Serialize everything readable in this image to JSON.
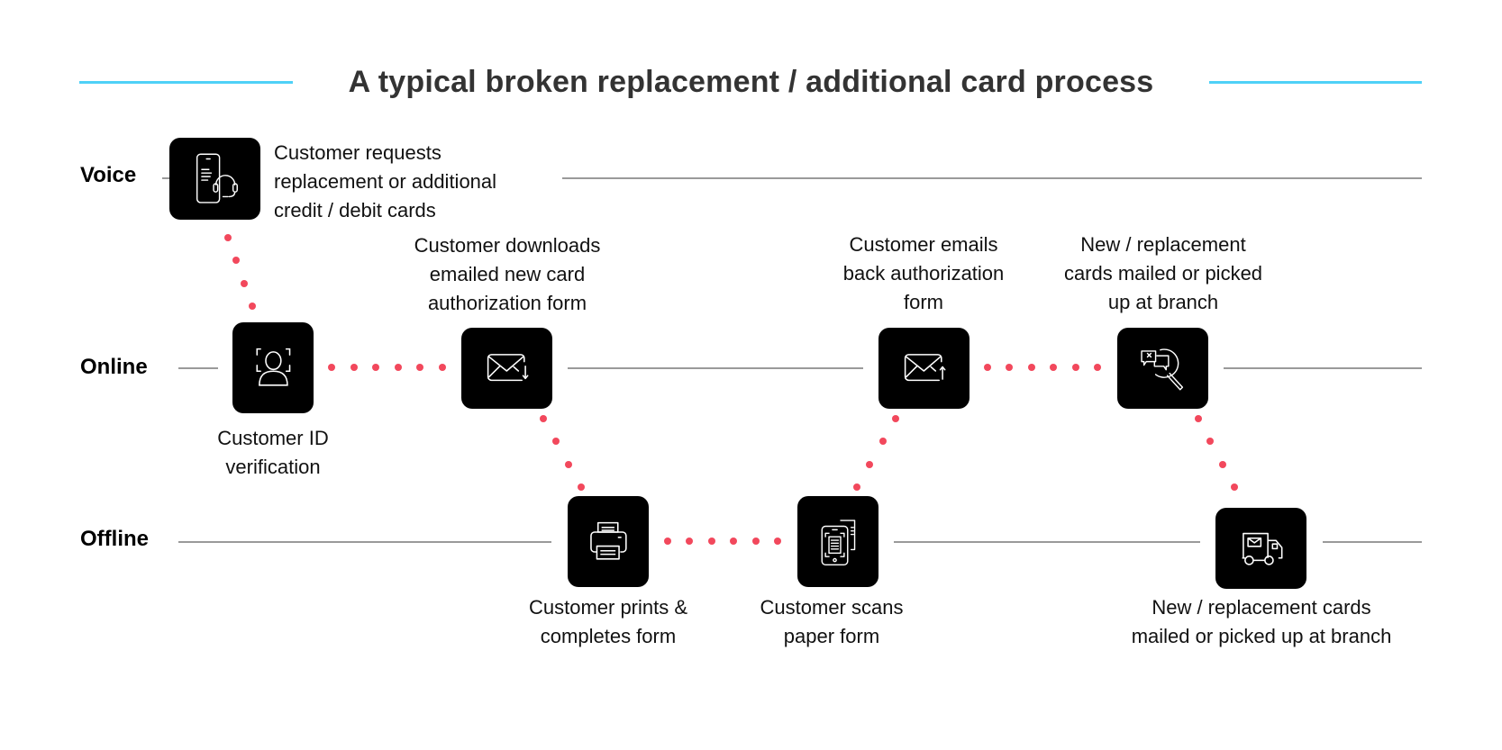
{
  "title": "A typical broken replacement / additional card process",
  "colors": {
    "accent_line": "#4fd1f7",
    "connector_dot": "#f2485c",
    "lane_line": "#9a9a9a",
    "icon_box": "#000000",
    "title": "#333333"
  },
  "lanes": [
    {
      "id": "voice",
      "label": "Voice"
    },
    {
      "id": "online",
      "label": "Online"
    },
    {
      "id": "offline",
      "label": "Offline"
    }
  ],
  "steps": [
    {
      "id": "request",
      "lane": "voice",
      "icon": "phone-headset-icon",
      "lines": [
        "Customer requests",
        "replacement or additional",
        "credit / debit cards"
      ]
    },
    {
      "id": "id-verification",
      "lane": "online",
      "icon": "face-id-icon",
      "lines": [
        "Customer ID",
        "verification"
      ]
    },
    {
      "id": "download-form",
      "lane": "online",
      "icon": "email-download-icon",
      "lines": [
        "Customer downloads",
        "emailed new card",
        "authorization form"
      ]
    },
    {
      "id": "print-form",
      "lane": "offline",
      "icon": "printer-icon",
      "lines": [
        "Customer prints &",
        "completes form"
      ]
    },
    {
      "id": "scan-form",
      "lane": "offline",
      "icon": "mobile-scan-icon",
      "lines": [
        "Customer scans",
        "paper form"
      ]
    },
    {
      "id": "email-back",
      "lane": "online",
      "icon": "email-upload-icon",
      "lines": [
        "Customer emails",
        "back authorization",
        "form"
      ]
    },
    {
      "id": "online-fulfil",
      "lane": "online",
      "icon": "chat-search-icon",
      "lines": [
        "New / replacement",
        "cards mailed or picked",
        "up at branch"
      ]
    },
    {
      "id": "offline-fulfil",
      "lane": "offline",
      "icon": "delivery-truck-icon",
      "lines": [
        "New / replacement cards",
        "mailed or picked up at branch"
      ]
    }
  ],
  "connections": [
    [
      "request",
      "id-verification"
    ],
    [
      "id-verification",
      "download-form"
    ],
    [
      "download-form",
      "print-form"
    ],
    [
      "print-form",
      "scan-form"
    ],
    [
      "scan-form",
      "email-back"
    ],
    [
      "email-back",
      "online-fulfil"
    ],
    [
      "online-fulfil",
      "offline-fulfil"
    ]
  ]
}
